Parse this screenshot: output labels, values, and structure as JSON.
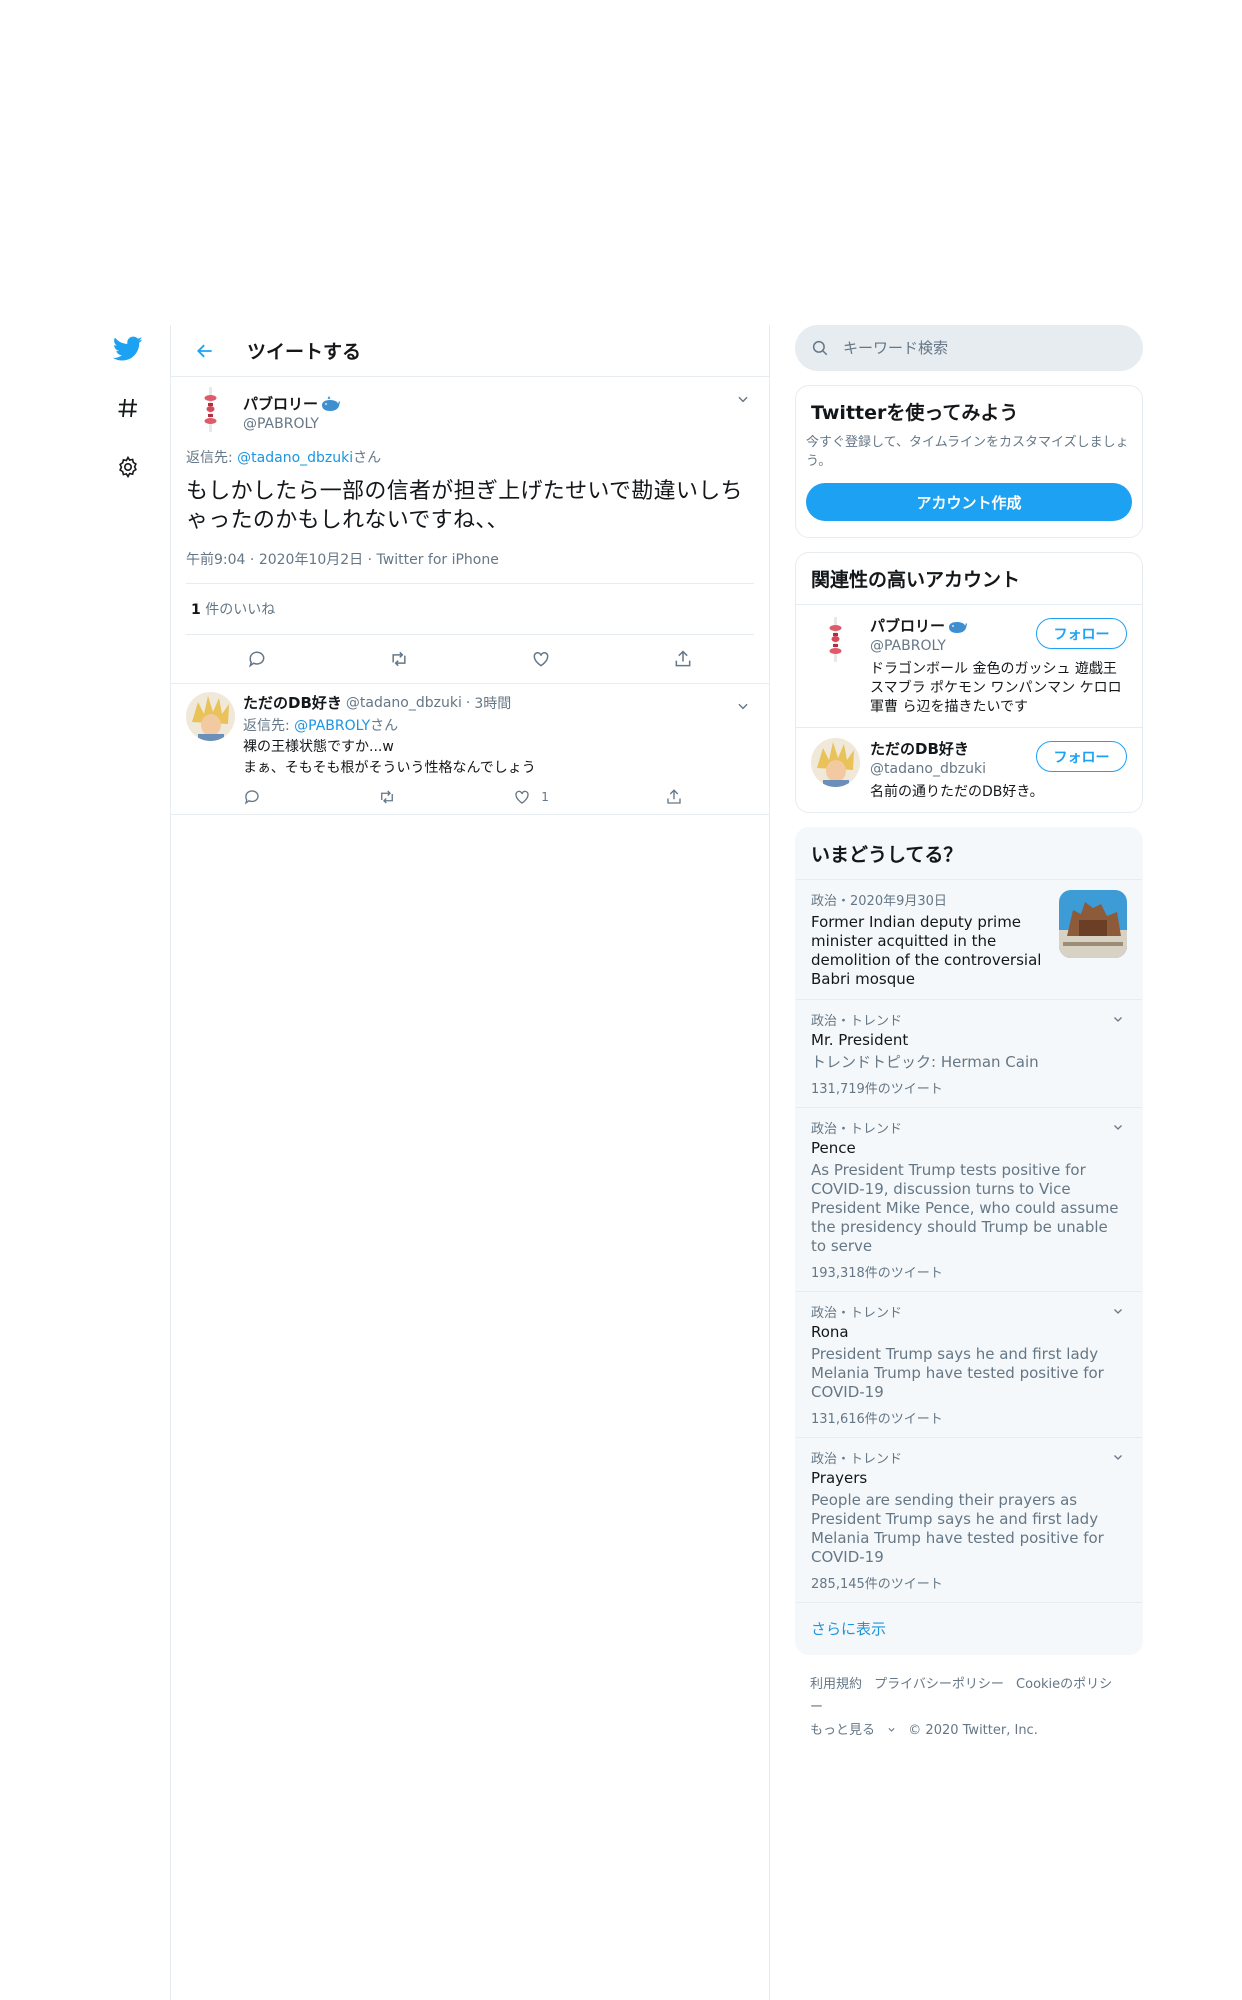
{
  "nav": {
    "items": [
      {
        "icon": "twitter-bird-icon"
      },
      {
        "icon": "hashtag-icon"
      },
      {
        "icon": "gear-icon"
      }
    ],
    "colors": {
      "brand": "#1da1f2"
    }
  },
  "header": {
    "title": "ツイートする"
  },
  "tweet": {
    "author_name": "パブロリー",
    "author_handle": "@PABROLY",
    "replying_prefix": "返信先: ",
    "replying_handle": "@tadano_dbzuki",
    "replying_suffix": "さん",
    "text": "もしかしたら一部の信者が担ぎ上げたせいで勘違いしちゃったのかもしれないですね、、",
    "time": "午前9:04",
    "date": "2020年10月2日",
    "source": "Twitter for iPhone",
    "likes_count": "1",
    "likes_label": "件のいいね"
  },
  "reply": {
    "author_name": "ただのDB好き",
    "author_handle": "@tadano_dbzuki",
    "time": "3時間",
    "replying_prefix": "返信先: ",
    "replying_handle": "@PABROLY",
    "replying_suffix": "さん",
    "line1": "裸の王様状態ですか...w",
    "line2": "まぁ、そもそも根がそういう性格なんでしょう",
    "like_count": "1"
  },
  "sidebar": {
    "search_placeholder": "キーワード検索",
    "signup": {
      "title": "Twitterを使ってみよう",
      "subtitle": "今すぐ登録して、タイムラインをカスタマイズしましょう。",
      "button": "アカウント作成"
    },
    "related": {
      "title": "関連性の高いアカウント",
      "follow_label": "フォロー",
      "accounts": [
        {
          "name": "パブロリー",
          "handle": "@PABROLY",
          "bio": "ドラゴンボール 金色のガッシュ 遊戯王 スマブラ ポケモン ワンパンマン ケロロ軍曹 ら辺を描きたいです"
        },
        {
          "name": "ただのDB好き",
          "handle": "@tadano_dbzuki",
          "bio": "名前の通りただのDB好き。"
        }
      ]
    },
    "trends": {
      "title": "いまどうしてる？",
      "news": {
        "meta": "政治・2020年9月30日",
        "headline": "Former Indian deputy prime minister acquitted in the demolition of the controversial Babri mosque"
      },
      "items": [
        {
          "meta": "政治・トレンド",
          "name": "Mr. President",
          "desc": "トレンドトピック: Herman Cain",
          "count": "131,719件のツイート"
        },
        {
          "meta": "政治・トレンド",
          "name": "Pence",
          "desc": "As President Trump tests positive for COVID-19, discussion turns to Vice President Mike Pence, who could assume the presidency should Trump be unable to serve",
          "count": "193,318件のツイート"
        },
        {
          "meta": "政治・トレンド",
          "name": "Rona",
          "desc": "President Trump says he and first lady Melania Trump have tested positive for COVID-19",
          "count": "131,616件のツイート"
        },
        {
          "meta": "政治・トレンド",
          "name": "Prayers",
          "desc": "People are sending their prayers as President Trump says he and first lady Melania Trump have tested positive for COVID-19",
          "count": "285,145件のツイート"
        }
      ],
      "show_more": "さらに表示"
    },
    "footer": {
      "links": [
        "利用規約",
        "プライバシーポリシー",
        "Cookieのポリシー"
      ],
      "more": "もっと見る",
      "copyright": "© 2020 Twitter, Inc."
    }
  }
}
